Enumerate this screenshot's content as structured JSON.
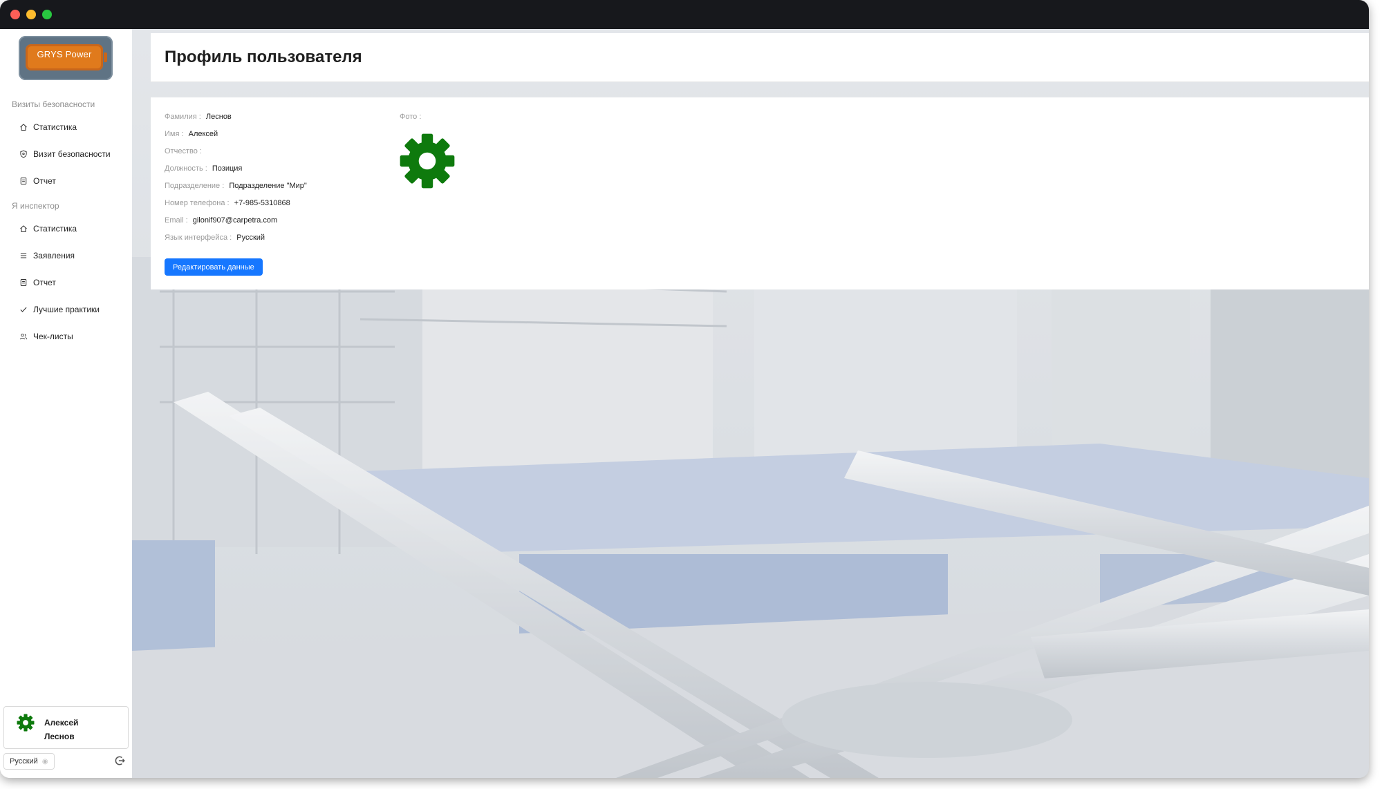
{
  "sidebar": {
    "logo": {
      "text": "GRYS Power"
    },
    "sections": [
      {
        "label": "Визиты безопасности",
        "items": [
          {
            "label": "Статистика",
            "icon": "home-icon"
          },
          {
            "label": "Визит безопасности",
            "icon": "shield-icon"
          },
          {
            "label": "Отчет",
            "icon": "file-icon"
          }
        ]
      },
      {
        "label": "Я инспектор",
        "items": [
          {
            "label": "Статистика",
            "icon": "home-icon"
          },
          {
            "label": "Заявления",
            "icon": "list-icon"
          },
          {
            "label": "Отчет",
            "icon": "file-icon"
          },
          {
            "label": "Лучшие практики",
            "icon": "check-icon"
          },
          {
            "label": "Чек-листы",
            "icon": "users-icon"
          }
        ]
      }
    ],
    "user": {
      "first_name": "Алексей",
      "last_name": "Леснов"
    },
    "language": "Русский"
  },
  "main": {
    "title": "Профиль пользователя",
    "profile": {
      "fields": [
        {
          "label": "Фамилия",
          "value": "Леснов"
        },
        {
          "label": "Имя",
          "value": "Алексей"
        },
        {
          "label": "Отчество",
          "value": ""
        },
        {
          "label": "Должность",
          "value": "Позиция"
        },
        {
          "label": "Подразделение",
          "value": "Подразделение \"Мир\""
        },
        {
          "label": "Номер телефона",
          "value": "+7-985-5310868"
        },
        {
          "label": "Email",
          "value": "gilonif907@carpetra.com"
        },
        {
          "label": "Язык интерфейса",
          "value": "Русский"
        }
      ],
      "photo_label": "Фото",
      "edit_button": "Редактировать данные"
    }
  },
  "colors": {
    "primary": "#1677ff",
    "avatar_gear": "#0e7a0d",
    "titlebar": "#17181c"
  }
}
